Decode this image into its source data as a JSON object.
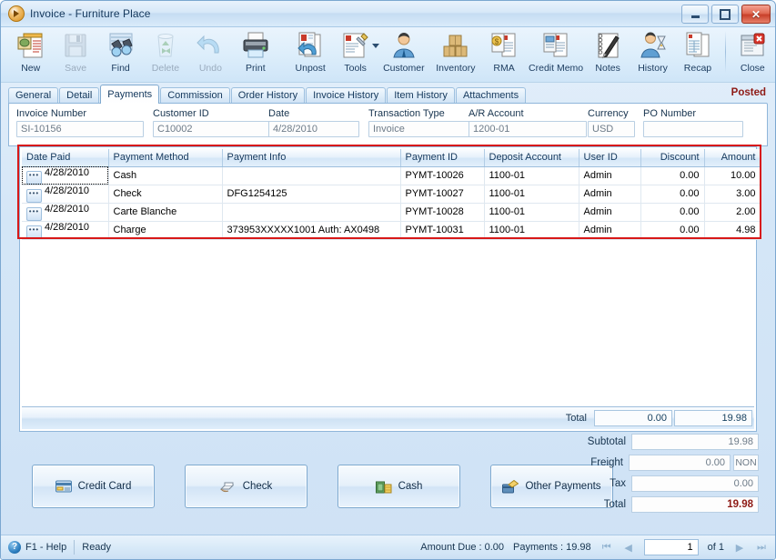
{
  "window": {
    "title": "Invoice - Furniture Place",
    "icon": "app-media-icon",
    "minimize_label": "–",
    "maximize_label": "□",
    "close_label": "✕"
  },
  "toolbar": {
    "items": [
      {
        "label": "New",
        "icon": "new-document-icon",
        "enabled": true
      },
      {
        "label": "Save",
        "icon": "floppy-disk-icon",
        "enabled": false
      },
      {
        "label": "Find",
        "icon": "binoculars-icon",
        "enabled": true
      },
      {
        "label": "Delete",
        "icon": "recycle-bin-icon",
        "enabled": false
      },
      {
        "label": "Undo",
        "icon": "undo-arrow-icon",
        "enabled": false
      },
      {
        "label": "Print",
        "icon": "printer-icon",
        "enabled": true
      },
      {
        "label": "Unpost",
        "icon": "unpost-icon",
        "enabled": true
      },
      {
        "label": "Tools",
        "icon": "tools-icon",
        "enabled": true,
        "dropdown": true
      },
      {
        "label": "Customer",
        "icon": "customer-person-icon",
        "enabled": true
      },
      {
        "label": "Inventory",
        "icon": "boxes-icon",
        "enabled": true
      },
      {
        "label": "RMA",
        "icon": "rma-money-document-icon",
        "enabled": true
      },
      {
        "label": "Credit Memo",
        "icon": "credit-memo-icon",
        "enabled": true
      },
      {
        "label": "Notes",
        "icon": "notepad-pen-icon",
        "enabled": true
      },
      {
        "label": "History",
        "icon": "history-person-hourglass-icon",
        "enabled": true
      },
      {
        "label": "Recap",
        "icon": "recap-report-icon",
        "enabled": true
      },
      {
        "label": "Close",
        "icon": "close-window-icon",
        "enabled": true
      }
    ]
  },
  "tabs": {
    "items": [
      {
        "label": "General",
        "active": false
      },
      {
        "label": "Detail",
        "active": false
      },
      {
        "label": "Payments",
        "active": true
      },
      {
        "label": "Commission",
        "active": false
      },
      {
        "label": "Order History",
        "active": false
      },
      {
        "label": "Invoice History",
        "active": false
      },
      {
        "label": "Item History",
        "active": false
      },
      {
        "label": "Attachments",
        "active": false
      }
    ],
    "status_badge": "Posted"
  },
  "header_fields": [
    {
      "label": "Invoice Number",
      "value": "SI-10156"
    },
    {
      "label": "Customer ID",
      "value": "C10002"
    },
    {
      "label": "Date",
      "value": "4/28/2010"
    },
    {
      "label": "Transaction Type",
      "value": "Invoice"
    },
    {
      "label": "A/R Account",
      "value": "1200-01"
    },
    {
      "label": "Currency",
      "value": "USD"
    },
    {
      "label": "PO Number",
      "value": ""
    }
  ],
  "grid": {
    "columns": [
      "Date Paid",
      "Payment Method",
      "Payment Info",
      "Payment ID",
      "Deposit Account",
      "User ID",
      "Discount",
      "Amount"
    ],
    "rows": [
      {
        "date_paid": "4/28/2010",
        "payment_method": "Cash",
        "payment_info": "",
        "payment_id": "PYMT-10026",
        "deposit_account": "1100-01",
        "user_id": "Admin",
        "discount": "0.00",
        "amount": "10.00",
        "selected": true
      },
      {
        "date_paid": "4/28/2010",
        "payment_method": "Check",
        "payment_info": "DFG1254125",
        "payment_id": "PYMT-10027",
        "deposit_account": "1100-01",
        "user_id": "Admin",
        "discount": "0.00",
        "amount": "3.00",
        "selected": false
      },
      {
        "date_paid": "4/28/2010",
        "payment_method": "Carte Blanche",
        "payment_info": "",
        "payment_id": "PYMT-10028",
        "deposit_account": "1100-01",
        "user_id": "Admin",
        "discount": "0.00",
        "amount": "2.00",
        "selected": false
      },
      {
        "date_paid": "4/28/2010",
        "payment_method": "Charge",
        "payment_info": "373953XXXXX1001 Auth: AX0498",
        "payment_id": "PYMT-10031",
        "deposit_account": "1100-01",
        "user_id": "Admin",
        "discount": "0.00",
        "amount": "4.98",
        "selected": false
      }
    ],
    "footer": {
      "total_label": "Total",
      "total_discount": "0.00",
      "total_amount": "19.98"
    }
  },
  "payment_buttons": [
    {
      "label": "Credit Card",
      "icon": "credit-card-icon"
    },
    {
      "label": "Check",
      "icon": "check-hand-icon"
    },
    {
      "label": "Cash",
      "icon": "cash-money-icon"
    },
    {
      "label": "Other Payments",
      "icon": "other-payments-icon"
    }
  ],
  "totals": {
    "subtotal_label": "Subtotal",
    "subtotal_value": "19.98",
    "freight_label": "Freight",
    "freight_value": "0.00",
    "freight_tax_code": "NON",
    "tax_label": "Tax",
    "tax_value": "0.00",
    "total_label": "Total",
    "total_value": "19.98"
  },
  "statusbar": {
    "help": "F1 - Help",
    "state": "Ready",
    "amount_due": "Amount Due : 0.00",
    "payments": "Payments : 19.98",
    "first_label": "⏮",
    "prev_label": "◀",
    "page_value": "1",
    "of_label": "of 1",
    "next_label": "▶",
    "last_label": "⏭"
  },
  "colors": {
    "accent_blue": "#7ba7d0",
    "posted_red": "#8e1a15",
    "selection_red": "#d81818",
    "title_text": "#15385c"
  }
}
